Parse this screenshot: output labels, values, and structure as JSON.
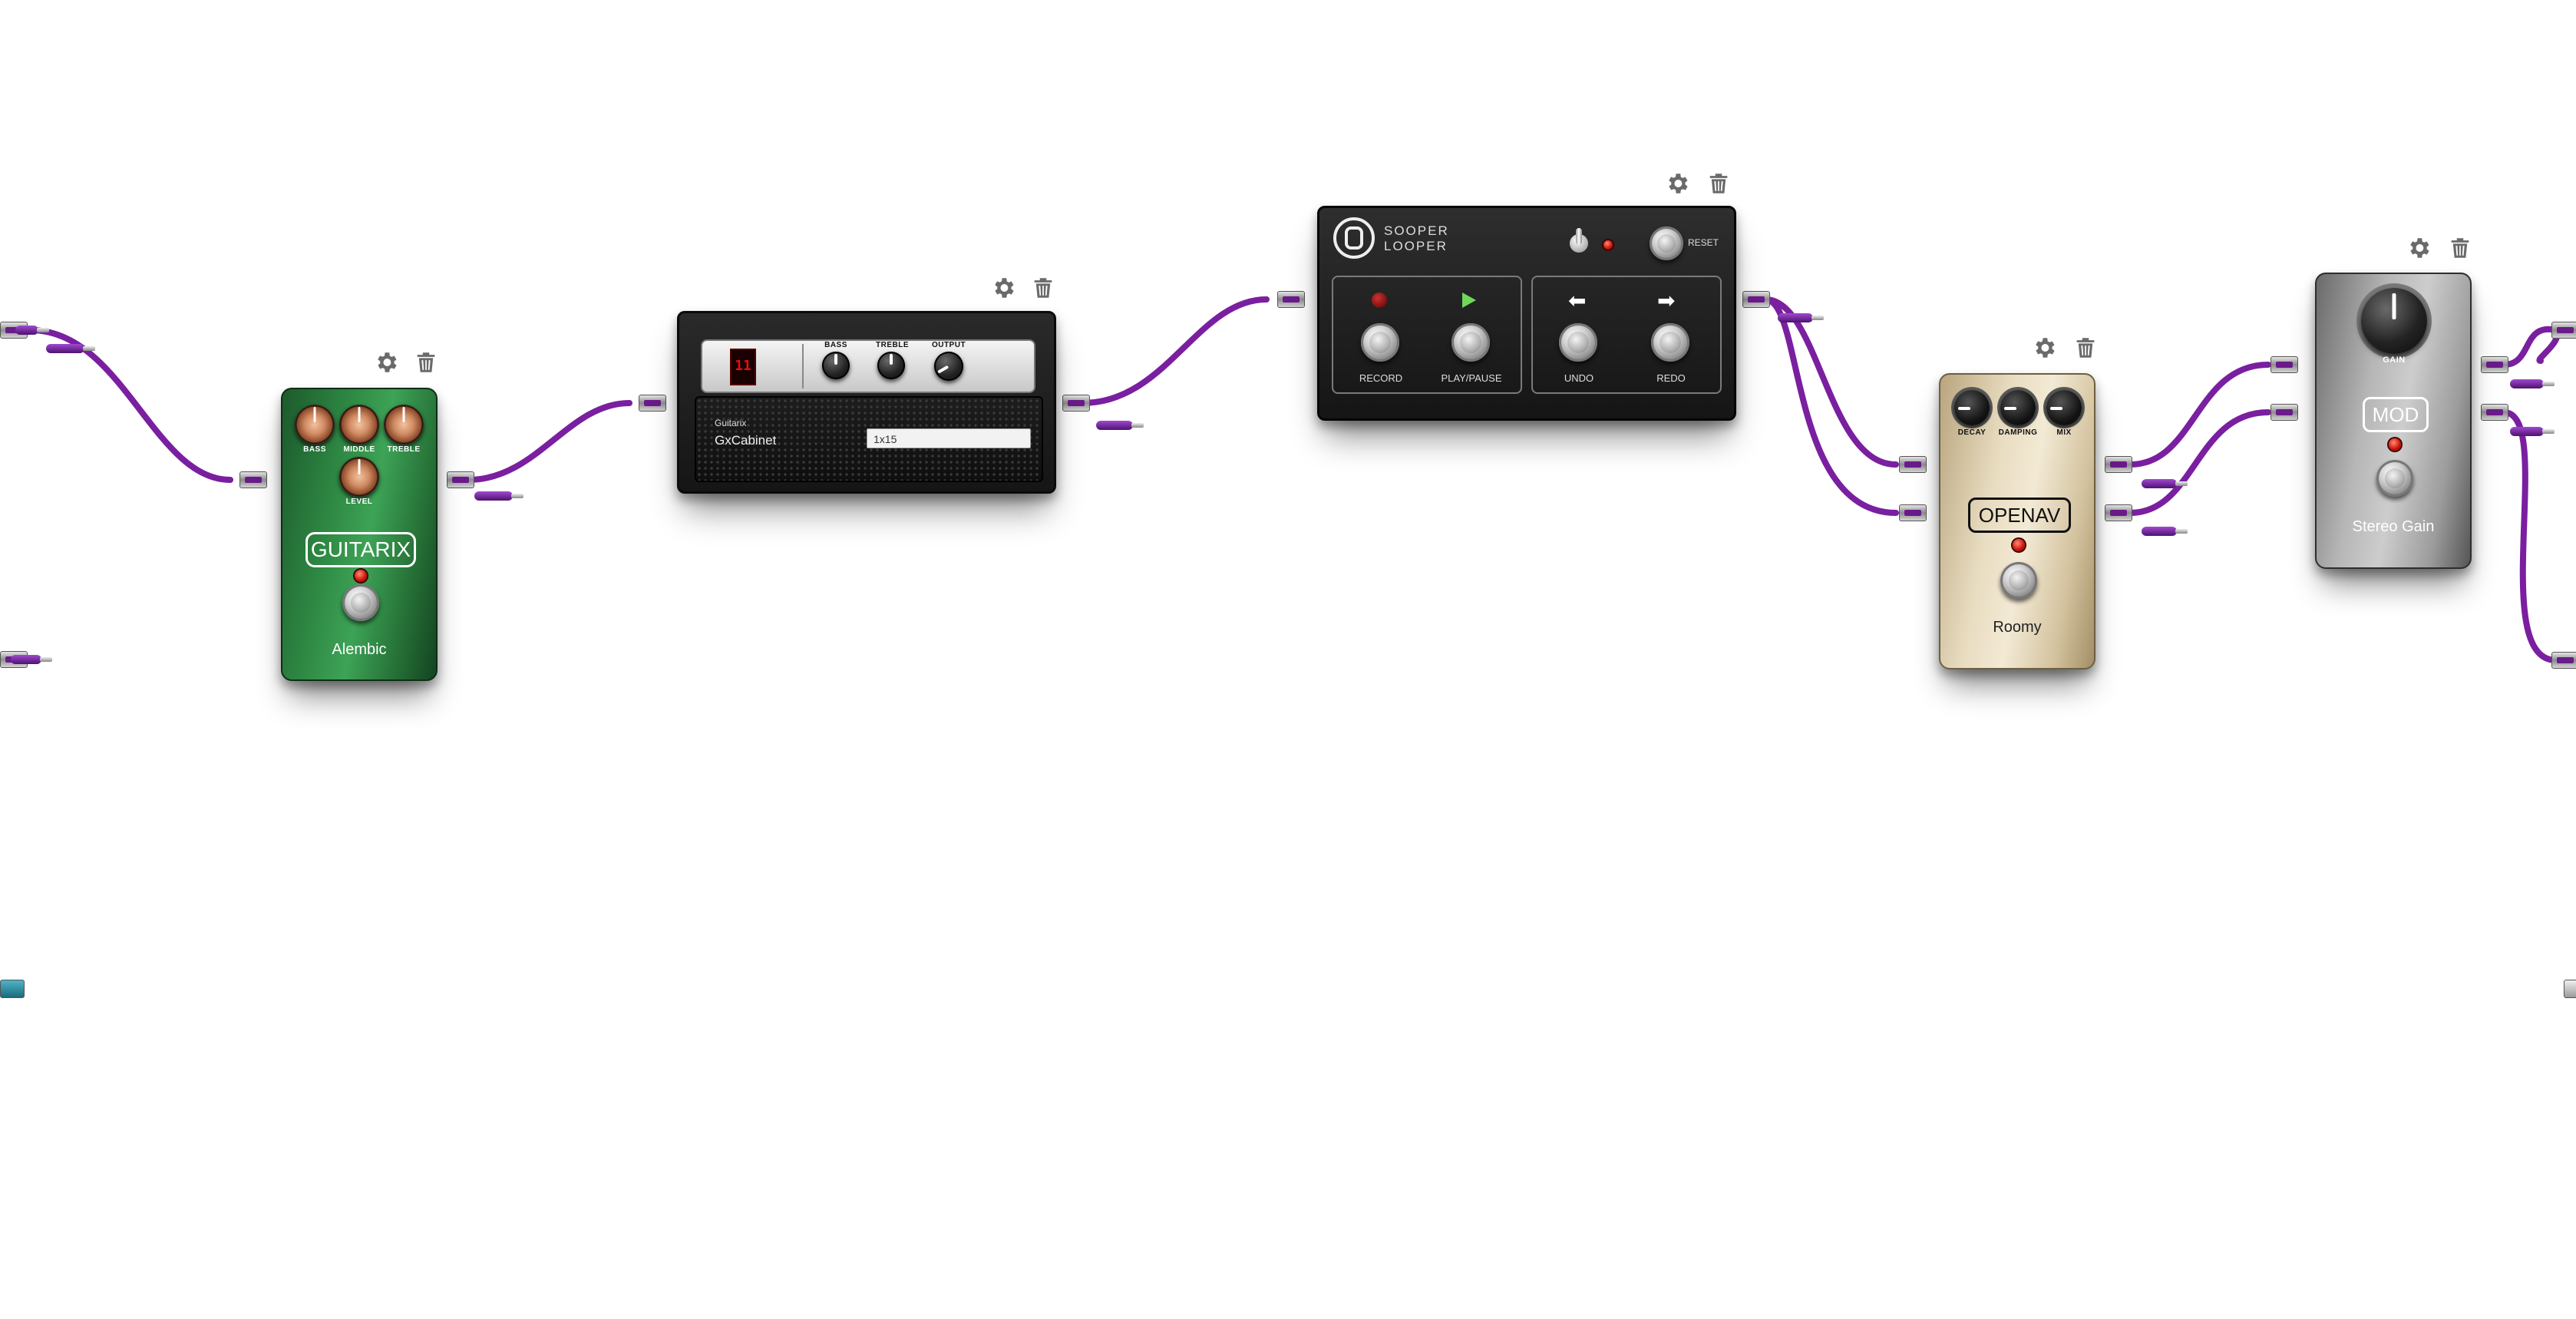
{
  "colors": {
    "cable": "#7a1fa0",
    "guitarix_body": "#2f8a44",
    "roomy_body": "#e8dcc0",
    "stereogain_body": "#b6b6b6",
    "led": "#d11a0a"
  },
  "icons": {
    "settings": "gear-icon",
    "delete": "trash-icon"
  },
  "pedals": {
    "guitarix": {
      "brand": "GUITARIX",
      "name": "Alembic",
      "knobs": [
        "BASS",
        "MIDDLE",
        "TREBLE",
        "LEVEL"
      ]
    },
    "gxcabinet": {
      "brand": "Guitarix",
      "name": "GxCabinet",
      "knobs": [
        "BASS",
        "TREBLE",
        "OUTPUT"
      ],
      "selected_cabinet": "1x15"
    },
    "looper": {
      "title_line1": "SOOPER",
      "title_line2": "LOOPER",
      "reset": "RESET",
      "buttons": [
        "RECORD",
        "PLAY/PAUSE",
        "UNDO",
        "REDO"
      ]
    },
    "roomy": {
      "brand": "OPENAV",
      "name": "Roomy",
      "knobs": [
        "DECAY",
        "DAMPING",
        "MIX"
      ]
    },
    "stereogain": {
      "brand": "MOD",
      "name": "Stereo Gain",
      "knobs": [
        "GAIN"
      ]
    }
  }
}
